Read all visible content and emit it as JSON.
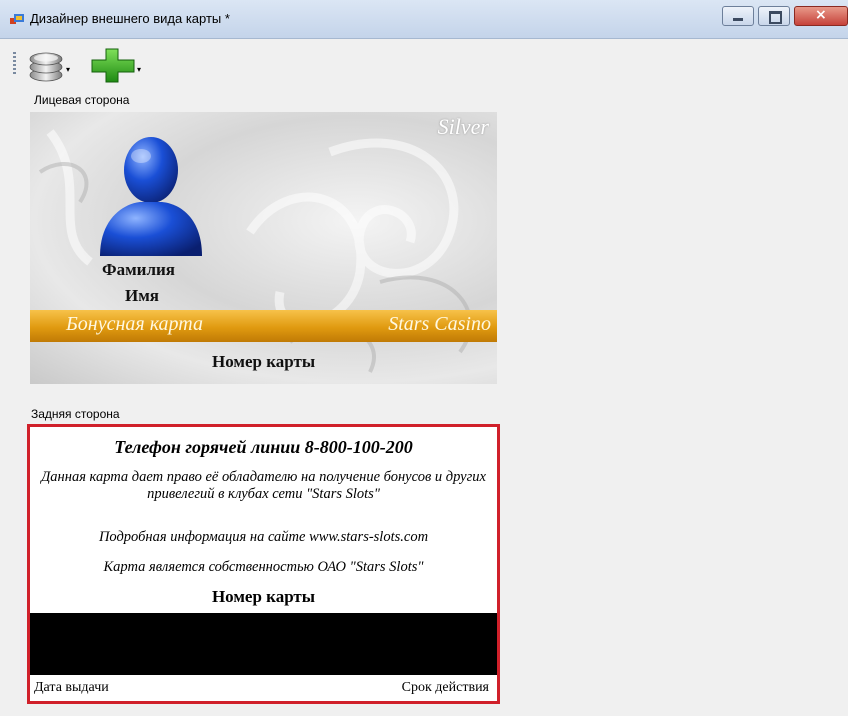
{
  "window": {
    "title": "Дизайнер внешнего вида карты *",
    "caption_buttons": {
      "minimize": "minimize-icon",
      "maximize": "maximize-icon",
      "close": "×"
    }
  },
  "toolbar": {
    "tools": [
      {
        "icon": "database-icon",
        "dropdown": "▾"
      },
      {
        "icon": "plus-icon",
        "dropdown": "▾"
      }
    ]
  },
  "front": {
    "section_label": "Лицевая сторона",
    "badge": "Silver",
    "surname": "Фамилия",
    "name": "Имя",
    "bonus_label": "Бонусная карта",
    "brand": "Stars Casino",
    "card_number": "Номер карты",
    "colors": {
      "band": "#e09a10",
      "avatar": "#1a4fd6"
    }
  },
  "back": {
    "section_label": "Задняя сторона",
    "hotline": "Телефон горячей линии 8-800-100-200",
    "description": "Данная карта дает  право её обладателю на получение бонусов и других привелегий в клубах сети \"Stars Slots\"",
    "info": "Подробная информация на сайте www.stars-slots.com",
    "property": "Карта является собственностью ОАО \"Stars Slots\"",
    "card_number": "Номер карты",
    "issue_date": "Дата выдачи",
    "expiry": "Срок действия",
    "colors": {
      "border": "#d0202a",
      "stripe": "#000000"
    }
  }
}
